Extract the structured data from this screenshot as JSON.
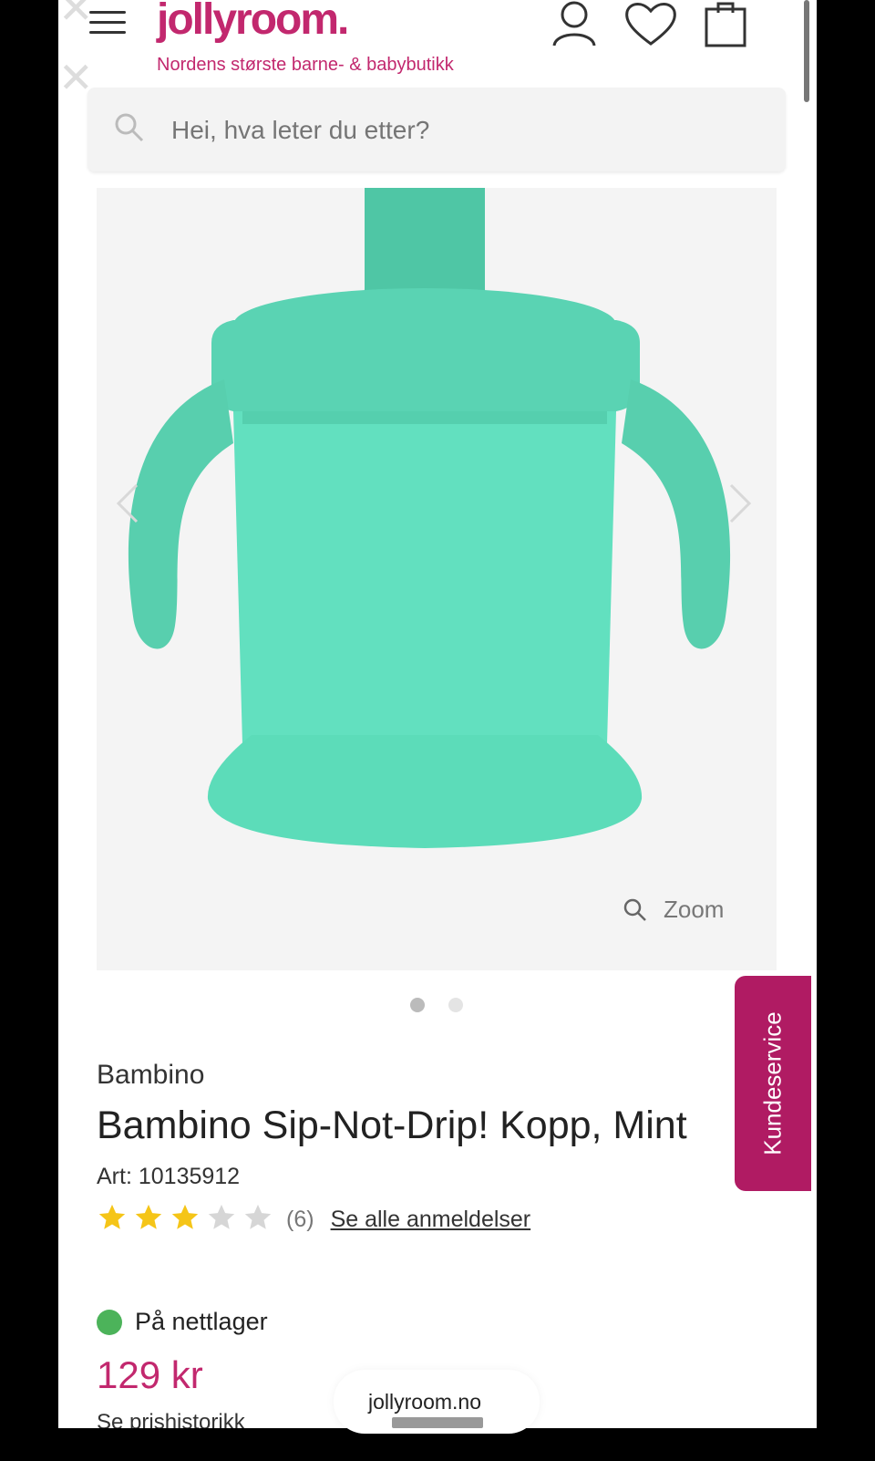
{
  "header": {
    "logo_text": "jollyroom.",
    "tagline": "Nordens største barne- & babybutikk",
    "brand_color": "#c2286e",
    "icons": [
      "menu-icon",
      "account-icon",
      "heart-icon",
      "cart-icon"
    ]
  },
  "search": {
    "placeholder": "Hei, hva leter du etter?"
  },
  "gallery": {
    "zoom_label": "Zoom",
    "image_description_icon": "product-image",
    "slide_active": 1,
    "slides_total": 2
  },
  "product": {
    "brand": "Bambino",
    "title": "Bambino Sip-Not-Drip! Kopp, Mint",
    "art_label": "Art:",
    "art_number": "10135912",
    "rating": 3,
    "rating_max": 5,
    "review_count": "(6)",
    "reviews_link": "Se alle anmeldelser",
    "stock_status": "På nettlager",
    "stock_color": "#4cb35a",
    "price": "129 kr",
    "price_history": "Se prishistorikk"
  },
  "support": {
    "label": "Kundeservice",
    "color": "#b01b63"
  },
  "browser": {
    "url": "jollyroom.no"
  }
}
